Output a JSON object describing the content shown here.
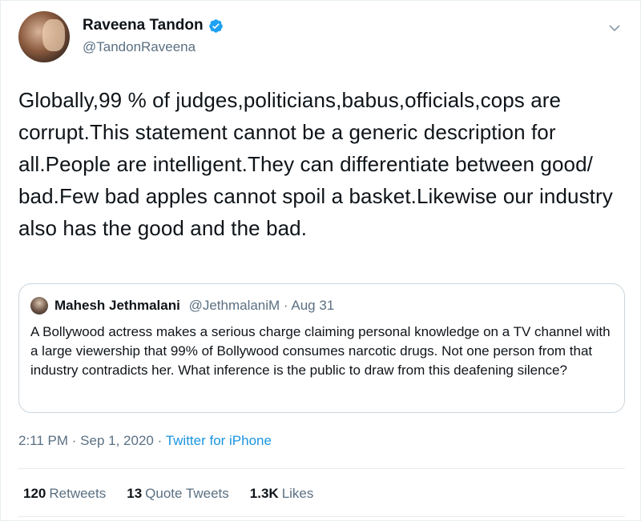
{
  "author": {
    "name": "Raveena Tandon",
    "handle": "@TandonRaveena",
    "verified_icon": "verified-badge-icon"
  },
  "tweet": {
    "text": "Globally,99 % of judges,politicians,babus,officials,cops are corrupt.This statement cannot be a generic description for all.People are intelligent.They can differentiate between good/ bad.Few bad apples cannot spoil a basket.Likewise our industry also has the good and the bad."
  },
  "quoted": {
    "name": "Mahesh Jethmalani",
    "handle": "@JethmalaniM",
    "separator": " · ",
    "date": "Aug 31",
    "text": "A Bollywood actress makes a serious charge claiming personal knowledge on a TV channel with a large viewership that 99% of Bollywood consumes narcotic drugs. Not one person from that industry contradicts her. What inference is the public to draw from this deafening silence?"
  },
  "meta": {
    "time": "2:11 PM",
    "sep1": " · ",
    "date": "Sep 1, 2020",
    "sep2": " · ",
    "source": "Twitter for iPhone"
  },
  "stats": {
    "retweets_count": "120",
    "retweets_label": "Retweets",
    "quotes_count": "13",
    "quotes_label": "Quote Tweets",
    "likes_count": "1.3K",
    "likes_label": "Likes"
  },
  "colors": {
    "link": "#1b95e0",
    "secondary_text": "#5b7083",
    "verified": "#1da1f2"
  }
}
